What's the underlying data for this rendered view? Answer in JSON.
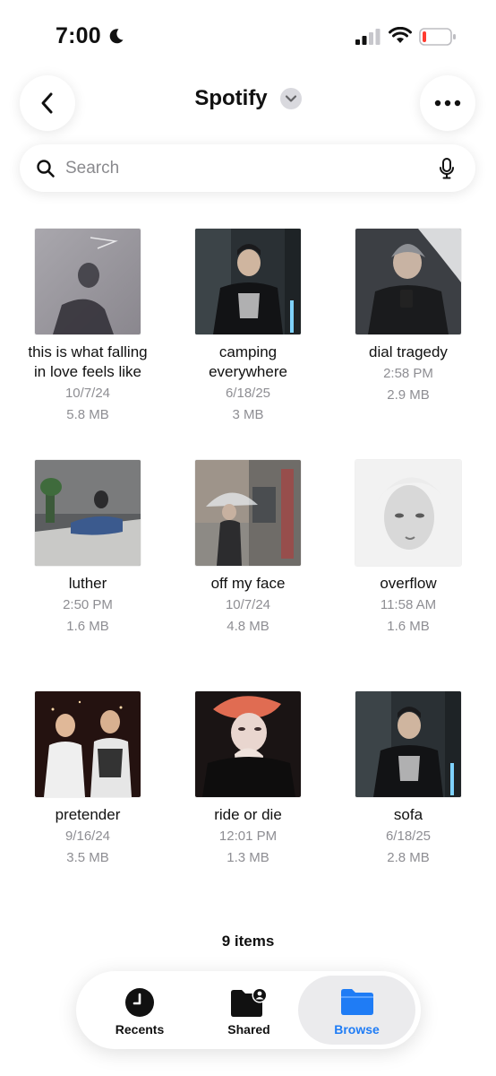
{
  "status_bar": {
    "time": "7:00",
    "icons": [
      "moon-icon",
      "cellular-signal-icon",
      "wifi-icon",
      "battery-low-icon"
    ]
  },
  "header": {
    "title": "Spotify",
    "back_icon": "chevron-left-icon",
    "title_menu_icon": "chevron-down-icon",
    "more_icon": "ellipsis-icon"
  },
  "search": {
    "placeholder": "Search",
    "value": "",
    "icons": [
      "search-icon",
      "microphone-icon"
    ]
  },
  "files": [
    {
      "name_lines": [
        "this is what falling",
        "in love feels like"
      ],
      "date": "10/7/24",
      "size": "5.8 MB"
    },
    {
      "name_lines": [
        "camping",
        "everywhere"
      ],
      "date": "6/18/25",
      "size": "3 MB"
    },
    {
      "name_lines": [
        "dial tragedy"
      ],
      "date": "2:58 PM",
      "size": "2.9 MB"
    },
    {
      "name_lines": [
        "luther"
      ],
      "date": "2:50 PM",
      "size": "1.6 MB"
    },
    {
      "name_lines": [
        "off my face"
      ],
      "date": "10/7/24",
      "size": "4.8 MB"
    },
    {
      "name_lines": [
        "overflow"
      ],
      "date": "11:58 AM",
      "size": "1.6 MB"
    },
    {
      "name_lines": [
        "pretender"
      ],
      "date": "9/16/24",
      "size": "3.5 MB"
    },
    {
      "name_lines": [
        "ride or die"
      ],
      "date": "12:01 PM",
      "size": "1.3 MB"
    },
    {
      "name_lines": [
        "sofa"
      ],
      "date": "6/18/25",
      "size": "2.8 MB"
    }
  ],
  "footer": {
    "item_count": "9 items"
  },
  "tab_bar": {
    "tabs": [
      {
        "label": "Recents",
        "icon": "clock-icon",
        "selected": false
      },
      {
        "label": "Shared",
        "icon": "shared-folder-icon",
        "selected": false
      },
      {
        "label": "Browse",
        "icon": "folder-icon",
        "selected": true
      }
    ],
    "accent_color": "#1f7cf5"
  }
}
